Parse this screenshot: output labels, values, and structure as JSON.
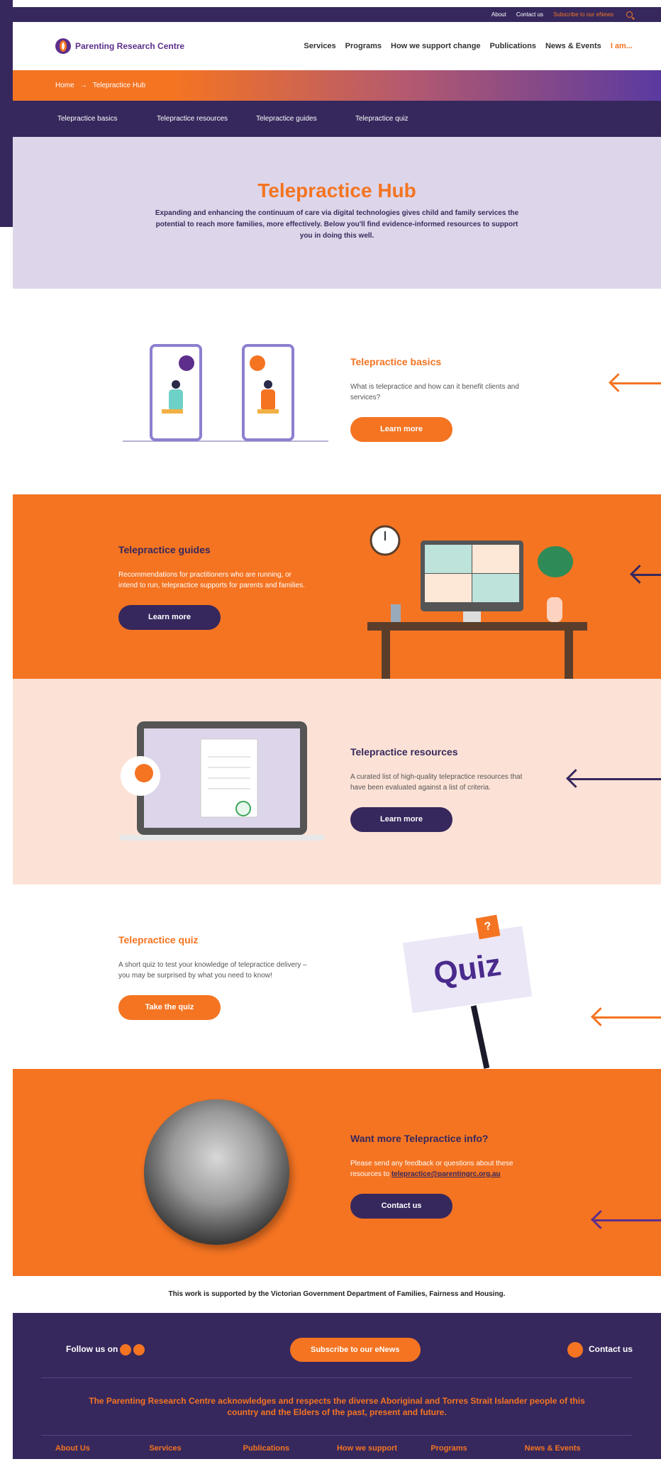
{
  "utility": {
    "about": "About",
    "contact": "Contact us",
    "subscribe": "Subscribe to our eNews"
  },
  "header": {
    "logo": "Parenting Research Centre",
    "nav": [
      "Services",
      "Programs",
      "How we support change",
      "Publications",
      "News & Events",
      "I am..."
    ]
  },
  "breadcrumb": {
    "home": "Home",
    "current": "Telepractice Hub"
  },
  "subnav": [
    "Telepractice basics",
    "Telepractice resources",
    "Telepractice guides",
    "Telepractice quiz"
  ],
  "hero": {
    "title": "Telepractice Hub",
    "text": "Expanding and enhancing the continuum of care via digital technologies gives child and family services the potential to reach more families, more effectively. Below you'll find evidence-informed resources to support you in doing this well."
  },
  "sections": {
    "basics": {
      "title": "Telepractice basics",
      "text": "What is telepractice and how can it benefit clients and services?",
      "button": "Learn more"
    },
    "guides": {
      "title": "Telepractice guides",
      "text": "Recommendations for practitioners who are running, or intend to run, telepractice supports for parents and families.",
      "button": "Learn more"
    },
    "resources": {
      "title": "Telepractice resources",
      "text": "A curated list of high-quality telepractice resources that have been evaluated against a list of criteria.",
      "button": "Learn more"
    },
    "quiz": {
      "title": "Telepractice quiz",
      "text": "A short quiz to test your knowledge of telepractice delivery – you may be surprised by what you need to know!",
      "button": "Take the quiz",
      "sign": "Quiz",
      "badge": "?"
    },
    "contact": {
      "title": "Want more Telepractice info?",
      "text": "Please send any feedback or questions about these resources to ",
      "email": "telepractice@parentingrc.org.au",
      "button": "Contact us"
    }
  },
  "support": "This work is supported by the Victorian Government Department of Families, Fairness and Housing.",
  "footer": {
    "follow": "Follow us on",
    "subscribe": "Subscribe to our eNews",
    "contact": "Contact us",
    "ack": "The Parenting Research Centre acknowledges and respects the diverse Aboriginal and Torres Strait Islander people of this country and the Elders of the past, present and future.",
    "links": [
      "About Us",
      "Services",
      "Publications",
      "How we support",
      "Programs",
      "News & Events"
    ]
  },
  "colors": {
    "orange": "#f47422",
    "purple": "#36285d",
    "lavender": "#ddd6ea",
    "peach": "#fce2d6"
  }
}
